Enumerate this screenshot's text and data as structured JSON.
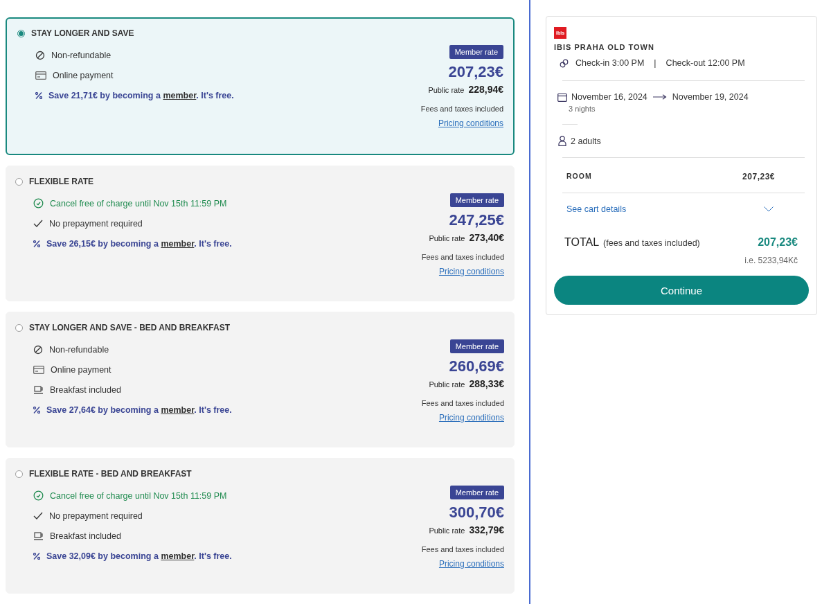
{
  "rates": [
    {
      "title": "STAY LONGER AND SAVE",
      "selected": true,
      "features": [
        {
          "kind": "nonrefundable",
          "text": "Non-refundable"
        },
        {
          "kind": "payment",
          "text": "Online payment"
        }
      ],
      "save": {
        "before": "Save 21,71€ by becoming a ",
        "link": "member",
        "after": ". It's free."
      },
      "badge": "Member rate",
      "member_price": "207,23€",
      "public_label": "Public rate",
      "public_price": "228,94€",
      "fees": "Fees and taxes included",
      "conditions": "Pricing conditions"
    },
    {
      "title": "FLEXIBLE RATE",
      "selected": false,
      "features": [
        {
          "kind": "cancel",
          "text": "Cancel free of charge until Nov 15th 11:59 PM"
        },
        {
          "kind": "noprepay",
          "text": "No prepayment required"
        }
      ],
      "save": {
        "before": "Save 26,15€ by becoming a ",
        "link": "member",
        "after": ". It's free."
      },
      "badge": "Member rate",
      "member_price": "247,25€",
      "public_label": "Public rate",
      "public_price": "273,40€",
      "fees": "Fees and taxes included",
      "conditions": "Pricing conditions"
    },
    {
      "title": "STAY LONGER AND SAVE - BED AND BREAKFAST",
      "selected": false,
      "features": [
        {
          "kind": "nonrefundable",
          "text": "Non-refundable"
        },
        {
          "kind": "payment",
          "text": "Online payment"
        },
        {
          "kind": "breakfast",
          "text": "Breakfast included"
        }
      ],
      "save": {
        "before": "Save 27,64€ by becoming a ",
        "link": "member",
        "after": ". It's free."
      },
      "badge": "Member rate",
      "member_price": "260,69€",
      "public_label": "Public rate",
      "public_price": "288,33€",
      "fees": "Fees and taxes included",
      "conditions": "Pricing conditions"
    },
    {
      "title": "FLEXIBLE RATE - BED AND BREAKFAST",
      "selected": false,
      "features": [
        {
          "kind": "cancel",
          "text": "Cancel free of charge until Nov 15th 11:59 PM"
        },
        {
          "kind": "noprepay",
          "text": "No prepayment required"
        },
        {
          "kind": "breakfast",
          "text": "Breakfast included"
        }
      ],
      "save": {
        "before": "Save 32,09€ by becoming a ",
        "link": "member",
        "after": ". It's free."
      },
      "badge": "Member rate",
      "member_price": "300,70€",
      "public_label": "Public rate",
      "public_price": "332,79€",
      "fees": "Fees and taxes included",
      "conditions": "Pricing conditions"
    }
  ],
  "summary": {
    "logo_text": "ibis",
    "hotel": "IBIS PRAHA OLD TOWN",
    "check_in": "Check-in 3:00 PM",
    "separator": "|",
    "check_out": "Check-out 12:00 PM",
    "date_from": "November 16, 2024",
    "date_to": "November 19, 2024",
    "nights": "3 nights",
    "guests": "2 adults",
    "room_label": "ROOM",
    "room_price": "207,23€",
    "cart_link": "See cart details",
    "total_label": "TOTAL",
    "total_note": "(fees and taxes included)",
    "total_price": "207,23€",
    "converted": "i.e. 5233,94Kč",
    "button": "Continue"
  }
}
